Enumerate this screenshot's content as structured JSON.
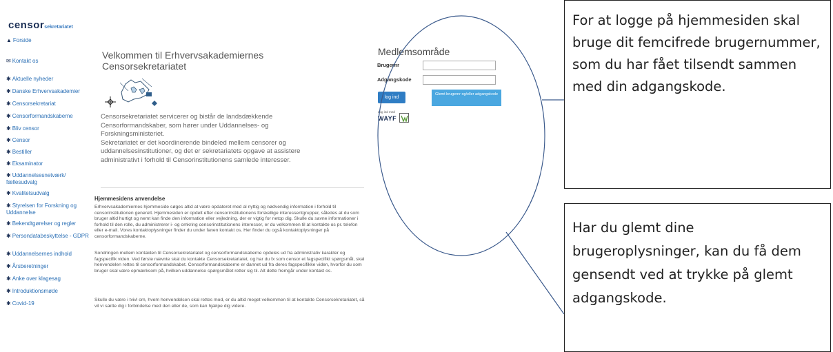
{
  "logo": {
    "main": "censor",
    "sub": "sekretariatet"
  },
  "nav": [
    {
      "label": "Forside",
      "icon": "home-icon",
      "glyph": "▲"
    },
    {
      "label": "Kontakt os",
      "icon": "envelope-icon",
      "glyph": "✉"
    },
    {
      "label": "Aktuelle nyheder",
      "icon": "asterisk-icon",
      "glyph": "✱"
    },
    {
      "label": "Danske Erhvervsakademier",
      "icon": "asterisk-icon",
      "glyph": "✱"
    },
    {
      "label": "Censorsekretariat",
      "icon": "asterisk-icon",
      "glyph": "✱"
    },
    {
      "label": "Censorformandskaberne",
      "icon": "asterisk-icon",
      "glyph": "✱"
    },
    {
      "label": "Bliv censor",
      "icon": "asterisk-icon",
      "glyph": "✱"
    },
    {
      "label": "Censor",
      "icon": "asterisk-icon",
      "glyph": "✱"
    },
    {
      "label": "Bestiller",
      "icon": "asterisk-icon",
      "glyph": "✱"
    },
    {
      "label": "Eksaminator",
      "icon": "asterisk-icon",
      "glyph": "✱"
    },
    {
      "label": "Uddannelsesnetværk/ fællesudvalg",
      "icon": "asterisk-icon",
      "glyph": "✱"
    },
    {
      "label": "Kvalitetsudvalg",
      "icon": "asterisk-icon",
      "glyph": "✱"
    },
    {
      "label": "Styrelsen for Forskning og Uddannelse",
      "icon": "asterisk-icon",
      "glyph": "✱"
    },
    {
      "label": "Bekendtgørelser og regler",
      "icon": "asterisk-icon",
      "glyph": "✱"
    },
    {
      "label": "Persondatabeskyttelse - GDPR",
      "icon": "asterisk-icon",
      "glyph": "✱"
    },
    {
      "label": "Uddannelsernes indhold",
      "icon": "asterisk-icon",
      "glyph": "✱"
    },
    {
      "label": "Årsberetninger",
      "icon": "asterisk-icon",
      "glyph": "✱"
    },
    {
      "label": "Anke over klagesag",
      "icon": "asterisk-icon",
      "glyph": "✱"
    },
    {
      "label": "Introduktionsmøde",
      "icon": "asterisk-icon",
      "glyph": "✱"
    },
    {
      "label": "Covid-19",
      "icon": "asterisk-icon",
      "glyph": "✱"
    }
  ],
  "main": {
    "welcome_title": "Velkommen til Erhvervsakademiernes Censorsekretariatet",
    "intro_1": "Censorsekretariatet servicerer og bistår de landsdækkende Censorformandskaber, som hører under Uddannelses- og Forskningsministeriet.",
    "intro_2": "Sekretariatet er det koordinerende bindeled mellem censorer og uddannelsesinstitutioner, og det er sekretariatets opgave at assistere administrativt i forhold til Censorinstitutionens samlede interesser.",
    "section_title": "Hjemmesidens anvendelse",
    "para_1": "Erhvervsakademiernes hjemmeside søges altid at være opdateret med al nyttig og nødvendig information i forhold til censorinstitutionen generelt. Hjemmesiden er opdelt efter censorinstitutionens forskellige interessentgrupper, således at du som bruger altid hurtigt og nemt kan finde den information eller vejledning, der er vigtig for netop dig. Skulle du savne informationer i forhold til den rolle, du administrerer i- og omkring censorinstitutionens interesser, er du velkommen til at kontakte os pr. telefon eller e-mail. Vores kontaktoplysninger finder du under fanen kontakt os. Her finder du også kontaktoplysninger på censorformandskaberne.",
    "para_2": "Sondringen mellem kontakten til Censorsekretariatet og censorformandskaberne opdeles ud fra administrativ karakter og fagspecifik viden. Ved første nævnte skal du kontakte Censorsekretariatet, og har du fx som censor et fagspecifikt spørgsmål, skal henvendelen rettes til censorformandskabet. Censorformandskaberne er dannet ud fra deres fagspecifikke viden, hvorfor du som bruger skal være opmærksom på, hvilken uddannelse spørgsmålet retter sig til. Alt dette fremgår under kontakt os.",
    "para_3": "Skulle du være i tvivl om, hvem henvendelsen skal rettes mod, er du altid meget velkommen til at kontakte Censorsekretariatet, så vil vi sætte dig i forbindelse med den eller de, som kan hjælpe dig videre."
  },
  "member": {
    "title": "Medlemsområde",
    "user_label": "Brugernr",
    "user_value": "",
    "pass_label": "Adgangskode",
    "pass_value": "",
    "login_button": "log ind",
    "forgot_button": "Glemt brugernr og/eller adgangskode",
    "wayf_small": "Log ind med",
    "wayf_word": "WAYF"
  },
  "callouts": {
    "top": "For at logge på hjemmesiden skal bruge dit femcifrede brugernummer, som du har fået tilsendt sammen med din adgangskode.",
    "bottom": "Har du glemt dine brugeroplysninger, kan du få dem gensendt ved at trykke på glemt adgangskode."
  },
  "colors": {
    "nav_link": "#2a6fb5",
    "login_button": "#2f7dc4",
    "forgot_button": "#4aa7e0",
    "logo_dark": "#1b2f55"
  }
}
